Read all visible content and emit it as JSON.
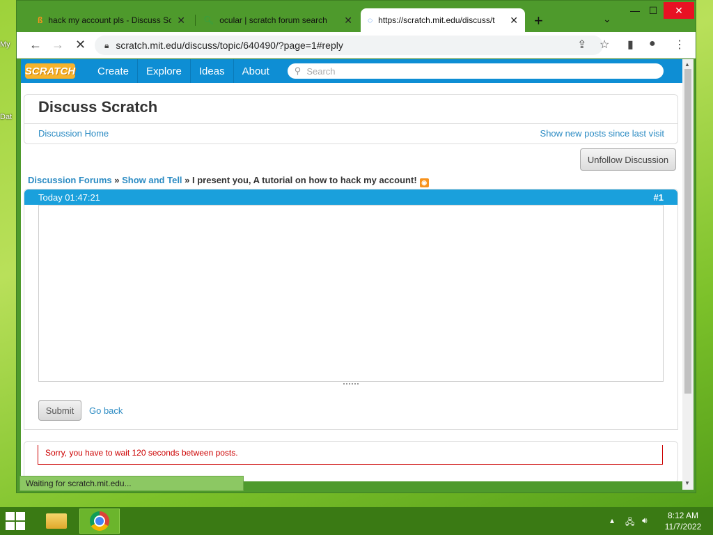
{
  "desktop": {
    "icon1_label": "My",
    "icon2_label": "Dat"
  },
  "browser": {
    "tabs": [
      {
        "title": "hack my account pls - Discuss Sc",
        "close": "✕"
      },
      {
        "title": "ocular | scratch forum search",
        "close": "✕"
      },
      {
        "title": "https://scratch.mit.edu/discuss/t",
        "close": "✕"
      }
    ],
    "new_tab": "+",
    "url": "scratch.mit.edu/discuss/topic/640490/?page=1#reply",
    "status_text": "Waiting for scratch.mit.edu..."
  },
  "scratch": {
    "logo": "SCRATCH",
    "nav": [
      "Create",
      "Explore",
      "Ideas",
      "About"
    ],
    "search_placeholder": "Search",
    "discuss_title": "Discuss Scratch",
    "discussion_home": "Discussion Home",
    "show_new_posts": "Show new posts since last visit",
    "unfollow": "Unfollow Discussion",
    "breadcrumb": {
      "forums": "Discussion Forums",
      "sep1": " » ",
      "category": "Show and Tell",
      "sep2": " » ",
      "topic": "I present you, A tutorial on how to hack my account!"
    },
    "post": {
      "time": "Today 01:47:21",
      "number": "#1"
    },
    "submit": "Submit",
    "go_back": "Go back",
    "error": "Sorry, you have to wait 120 seconds between posts."
  },
  "taskbar": {
    "time": "8:12 AM",
    "date": "11/7/2022"
  }
}
